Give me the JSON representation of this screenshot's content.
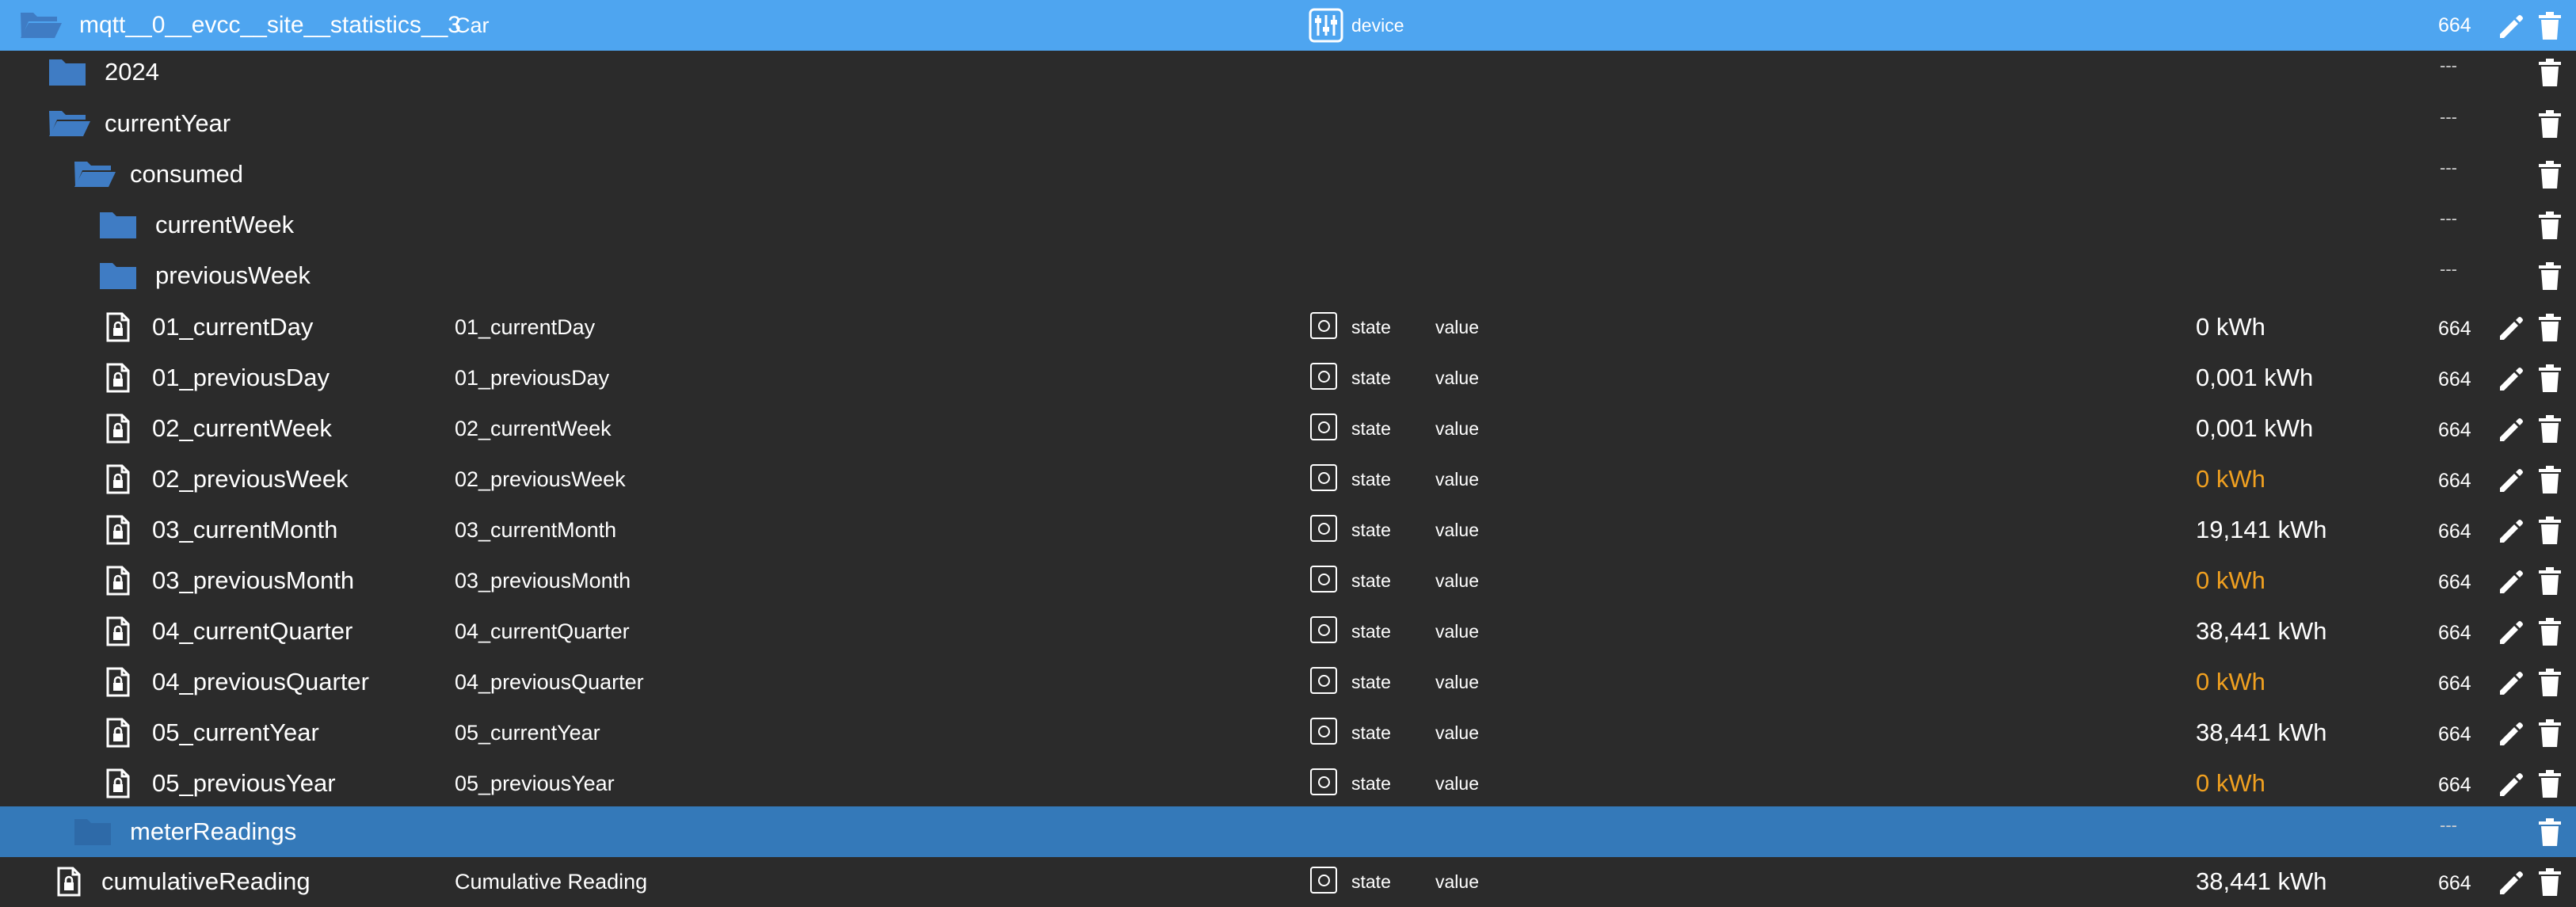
{
  "root": {
    "name": "mqtt__0__evcc__site__statistics__3",
    "object_name": "Car",
    "type_label": "device",
    "acl": "664"
  },
  "folders": [
    {
      "name": "2024",
      "state": "closed",
      "dash": "---"
    },
    {
      "name": "currentYear",
      "state": "open",
      "dash": "---"
    },
    {
      "name": "consumed",
      "state": "open",
      "dash": "---"
    },
    {
      "name": "currentWeek",
      "state": "closed",
      "dash": "---"
    },
    {
      "name": "previousWeek",
      "state": "closed",
      "dash": "---"
    }
  ],
  "states": [
    {
      "name": "01_currentDay",
      "object_name": "01_currentDay",
      "type_label": "state",
      "role": "value",
      "value": "0",
      "unit": "kWh",
      "value_color": "#ffffff",
      "acl": "664"
    },
    {
      "name": "01_previousDay",
      "object_name": "01_previousDay",
      "type_label": "state",
      "role": "value",
      "value": "0,001",
      "unit": "kWh",
      "value_color": "#ffffff",
      "acl": "664"
    },
    {
      "name": "02_currentWeek",
      "object_name": "02_currentWeek",
      "type_label": "state",
      "role": "value",
      "value": "0,001",
      "unit": "kWh",
      "value_color": "#ffffff",
      "acl": "664"
    },
    {
      "name": "02_previousWeek",
      "object_name": "02_previousWeek",
      "type_label": "state",
      "role": "value",
      "value": "0",
      "unit": "kWh",
      "value_color": "#f0a020",
      "acl": "664"
    },
    {
      "name": "03_currentMonth",
      "object_name": "03_currentMonth",
      "type_label": "state",
      "role": "value",
      "value": "19,141",
      "unit": "kWh",
      "value_color": "#ffffff",
      "acl": "664"
    },
    {
      "name": "03_previousMonth",
      "object_name": "03_previousMonth",
      "type_label": "state",
      "role": "value",
      "value": "0",
      "unit": "kWh",
      "value_color": "#f0a020",
      "acl": "664"
    },
    {
      "name": "04_currentQuarter",
      "object_name": "04_currentQuarter",
      "type_label": "state",
      "role": "value",
      "value": "38,441",
      "unit": "kWh",
      "value_color": "#ffffff",
      "acl": "664"
    },
    {
      "name": "04_previousQuarter",
      "object_name": "04_previousQuarter",
      "type_label": "state",
      "role": "value",
      "value": "0",
      "unit": "kWh",
      "value_color": "#f0a020",
      "acl": "664"
    },
    {
      "name": "05_currentYear",
      "object_name": "05_currentYear",
      "type_label": "state",
      "role": "value",
      "value": "38,441",
      "unit": "kWh",
      "value_color": "#ffffff",
      "acl": "664"
    },
    {
      "name": "05_previousYear",
      "object_name": "05_previousYear",
      "type_label": "state",
      "role": "value",
      "value": "0",
      "unit": "kWh",
      "value_color": "#f0a020",
      "acl": "664"
    }
  ],
  "selected_folder": {
    "name": "meterReadings",
    "state": "closed",
    "dash": "---"
  },
  "last_state": {
    "name": "cumulativeReading",
    "object_name": "Cumulative Reading",
    "type_label": "state",
    "role": "value",
    "value": "38,441",
    "unit": "kWh",
    "value_color": "#ffffff",
    "acl": "664"
  },
  "colors": {
    "root_background": "#4ea5f0",
    "selected_background": "#3479b9",
    "list_background": "#2b2b2b",
    "folder_icon": "#3f7cc4",
    "warning_value": "#f0a020"
  },
  "icons": {
    "folder_closed": "folder-icon",
    "folder_open": "folder-open-icon",
    "state_file": "file-lock-icon",
    "state_type": "state-type-icon",
    "device_type": "device-type-icon",
    "edit": "pencil-icon",
    "delete": "trash-icon"
  }
}
